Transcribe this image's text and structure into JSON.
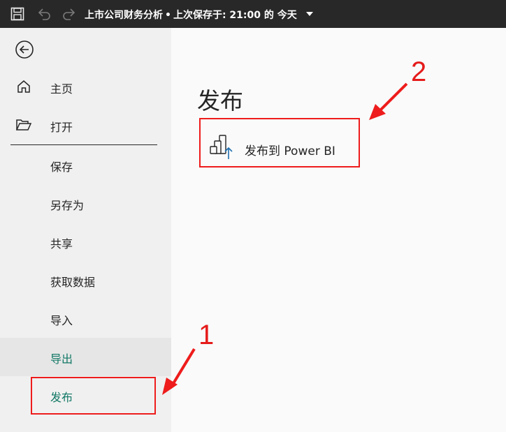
{
  "titlebar": {
    "title": "上市公司财务分析",
    "separator": "•",
    "save_status": "上次保存于: 21:00 的 今天",
    "icons": [
      "save-icon",
      "undo-icon",
      "redo-icon",
      "caret-down-icon"
    ]
  },
  "sidebar": {
    "back_icon": "back-arrow-icon",
    "items": [
      {
        "label": "主页",
        "icon": "home-icon"
      },
      {
        "label": "打开",
        "icon": "folder-open-icon"
      },
      {
        "label": "保存"
      },
      {
        "label": "另存为"
      },
      {
        "label": "共享"
      },
      {
        "label": "获取数据"
      },
      {
        "label": "导入"
      },
      {
        "label": "导出"
      },
      {
        "label": "发布"
      }
    ]
  },
  "main": {
    "heading": "发布",
    "publish_option": {
      "label": "发布到 Power BI",
      "icon": "publish-powerbi-icon"
    }
  },
  "annotations": [
    {
      "number": "1"
    },
    {
      "number": "2"
    }
  ],
  "colors": {
    "accent": "#117865",
    "annotation": "#ee1c1c",
    "titlebar": "#282828"
  }
}
